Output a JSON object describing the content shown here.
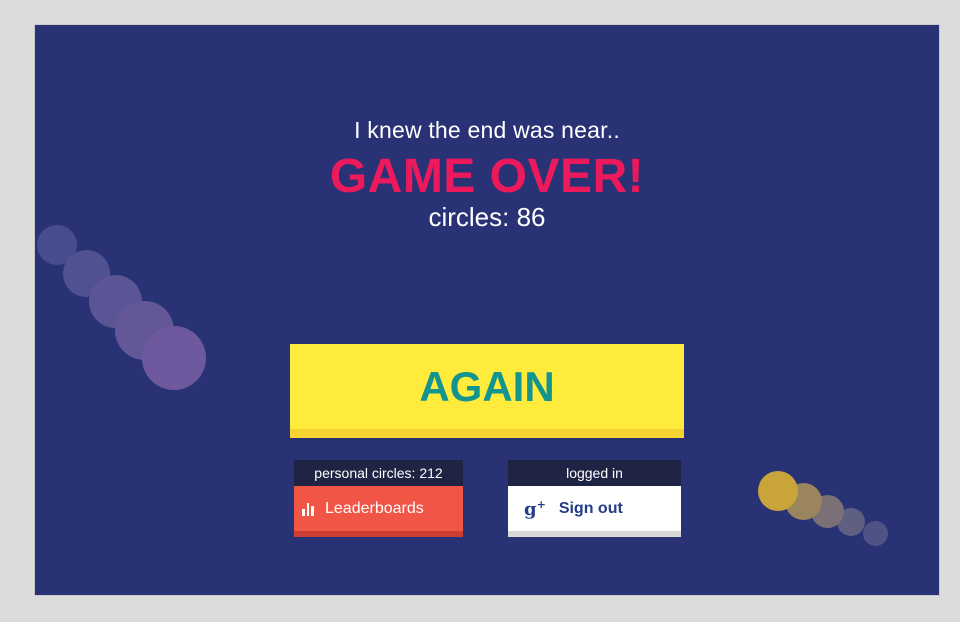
{
  "game": {
    "subtitle": "I knew the end was near..",
    "title": "GAME OVER!",
    "score_line": "circles: 86",
    "again_label": "AGAIN"
  },
  "leaderboard_card": {
    "header": "personal circles: 212",
    "button_label": "Leaderboards",
    "icon": "bar-chart-icon"
  },
  "account_card": {
    "header": "logged in",
    "button_label": "Sign out",
    "icon": "google-plus-icon"
  },
  "colors": {
    "background": "#293275",
    "title": "#ec1a5d",
    "again_button": "#ffeb3b",
    "again_text": "#13948e",
    "leaderboards_button": "#f05545",
    "purple_trail": "#6e589e",
    "gold_trail": "#c9a43a"
  }
}
